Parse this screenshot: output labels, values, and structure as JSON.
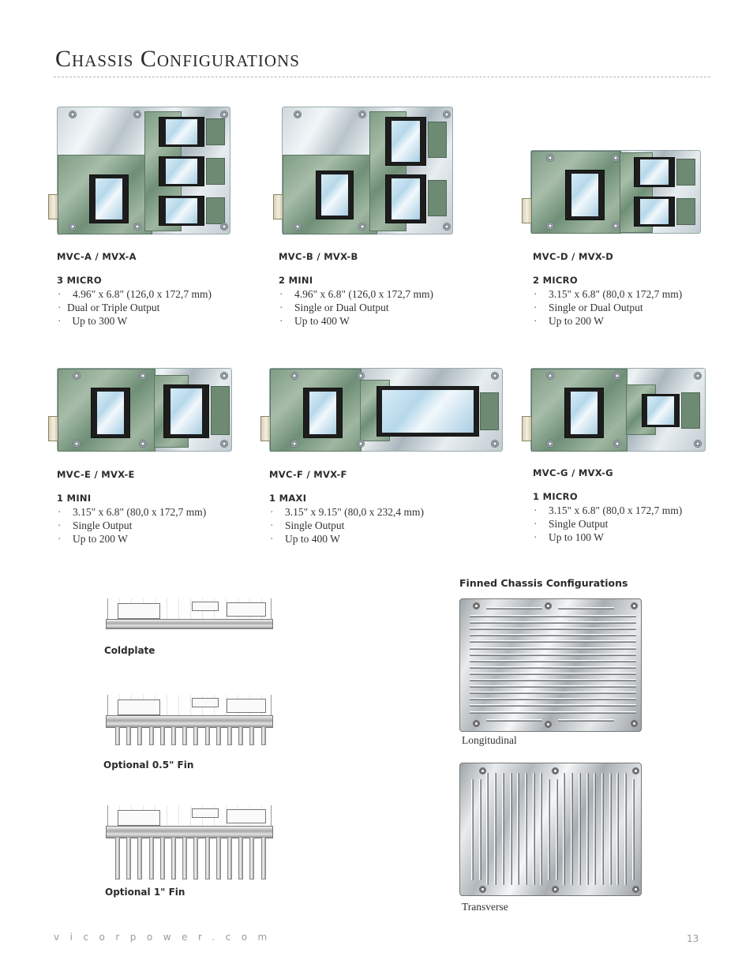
{
  "page": {
    "title": "Chassis Configurations",
    "footer_url": "vicorpower.com",
    "page_number": "13"
  },
  "configurations": [
    {
      "model": "MVC-A / MVX-A",
      "type": "3 MICRO",
      "features": [
        "4.96\" x 6.8\"  (126,0 x 172,7 mm)",
        "Dual or Triple Output",
        " Up to 300 W"
      ]
    },
    {
      "model": "MVC-B / MVX-B",
      "type": "2 MINI",
      "features": [
        "4.96\" x 6.8\"  (126,0 x 172,7 mm)",
        "Single or Dual Output",
        "Up to 400 W"
      ]
    },
    {
      "model": "MVC-D / MVX-D",
      "type": "2 MICRO",
      "features": [
        "3.15\" x 6.8\"  (80,0 x 172,7 mm)",
        "Single or Dual Output",
        "Up to 200 W"
      ]
    },
    {
      "model": "MVC-E / MVX-E",
      "type": "1 MINI",
      "features": [
        "3.15\" x 6.8\"  (80,0 x 172,7 mm)",
        "Single Output",
        "Up to 200 W"
      ]
    },
    {
      "model": "MVC-F / MVX-F",
      "type": "1 MAXI",
      "features": [
        "3.15\" x 9.15\"  (80,0 x 232,4 mm)",
        "Single Output",
        "Up to 400 W"
      ]
    },
    {
      "model": "MVC-G / MVX-G",
      "type": "1 MICRO",
      "features": [
        "3.15\" x 6.8\"  (80,0 x 172,7 mm)",
        "Single Output",
        "Up to 100 W"
      ]
    }
  ],
  "side_views": [
    {
      "caption": "Coldplate"
    },
    {
      "caption": "Optional 0.5\" Fin"
    },
    {
      "caption": "Optional 1\" Fin"
    }
  ],
  "finned": {
    "heading": "Finned Chassis Configurations",
    "items": [
      {
        "caption": "Longitudinal"
      },
      {
        "caption": "Transverse"
      }
    ]
  },
  "bullet_glyph": "·"
}
